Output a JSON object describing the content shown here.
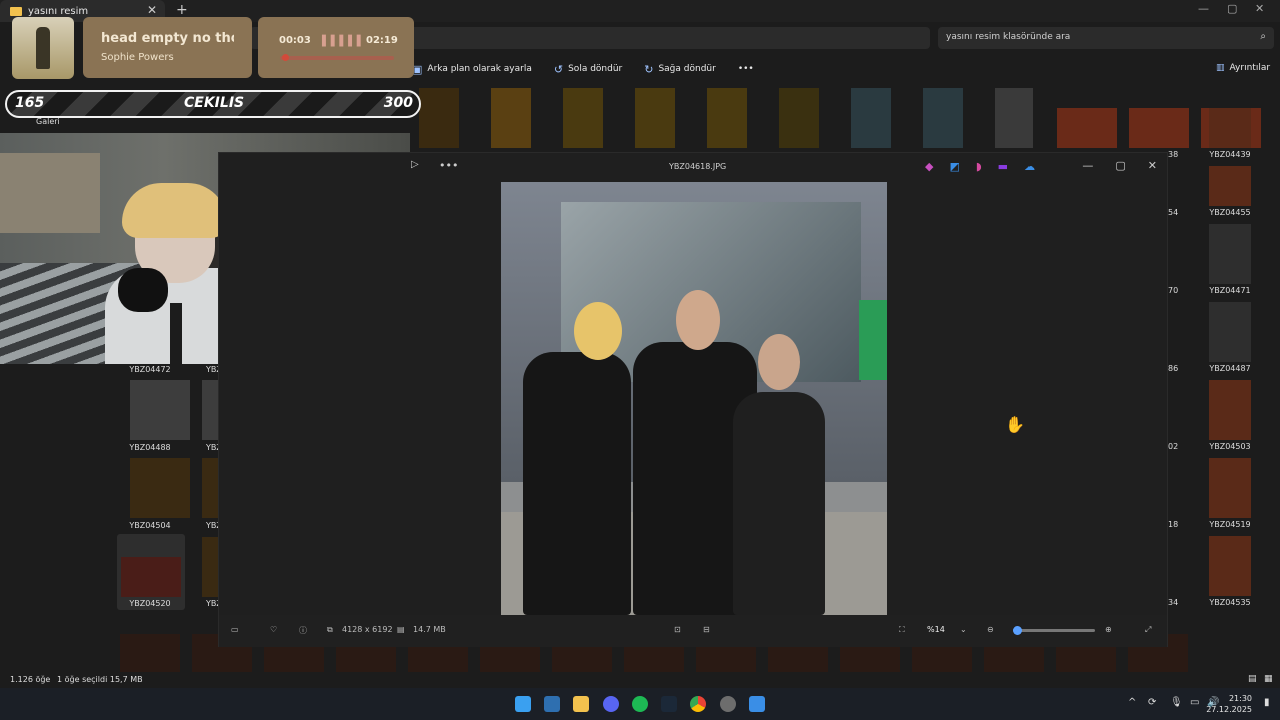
{
  "window": {
    "tab_title": "yasını resim",
    "tab_close": "✕",
    "tab_new": "+",
    "search_placeholder": "yasını resim klasöründe ara"
  },
  "toolbar": {
    "items": [
      {
        "label": "Arka plan olarak ayarla",
        "icon": "wallpaper-icon"
      },
      {
        "label": "Sola döndür",
        "icon": "rotate-left-icon"
      },
      {
        "label": "Sağa döndür",
        "icon": "rotate-right-icon"
      }
    ],
    "more": "•••",
    "details_label": "Ayrıntılar"
  },
  "nav": {
    "galeri": "Galeri"
  },
  "now_playing": {
    "title": "head empty no thoughts",
    "artist": "Sophie Powers",
    "current_time": "00:03",
    "duration": "02:19",
    "progress": 0.02
  },
  "cekilis": {
    "left_value": "165",
    "label": "CEKILIS",
    "right_value": "300"
  },
  "thumbnails": {
    "left": [
      {
        "label": "YBZ04472"
      },
      {
        "label": "YBZ04488"
      },
      {
        "label": "YBZ04504"
      },
      {
        "label": "YBZ04520"
      }
    ],
    "left_partial": [
      "YBZ",
      "YBZ",
      "YBZ",
      "YBZ"
    ],
    "right": [
      {
        "label": "YBZ04439"
      },
      {
        "label": "YBZ04455"
      },
      {
        "label": "YBZ04471"
      },
      {
        "label": "YBZ04487"
      },
      {
        "label": "YBZ04503"
      },
      {
        "label": "YBZ04519"
      },
      {
        "label": "YBZ04535"
      }
    ],
    "right_partial": [
      "38",
      "54",
      "70",
      "86",
      "02",
      "18",
      "34"
    ]
  },
  "viewer": {
    "filename": "YBZ04618.JPG",
    "more": "•••",
    "dimensions": "4128 x 6192",
    "file_size": "14.7 MB",
    "zoom": "%14",
    "zoom_level": 0.0
  },
  "status": {
    "item_count": "1.126 öğe",
    "selection": "1 öğe seçildi  15,7 MB"
  },
  "clock": {
    "time": "21:30",
    "date": "27.12.2025"
  },
  "colors": {
    "now_playing_bg": "#8a7354",
    "accent": "#5aa0ff",
    "progress": "#d24a3a"
  }
}
